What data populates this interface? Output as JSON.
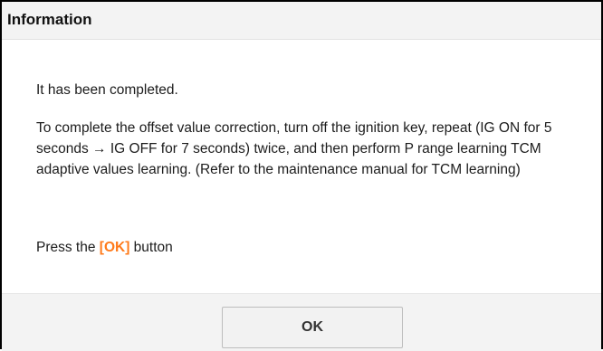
{
  "dialog": {
    "title": "Information",
    "message_line1": "It has been completed.",
    "message_body": "To complete the offset value correction, turn off the ignition key, repeat (IG ON for 5 seconds → IG OFF for 7 seconds) twice, and then perform P range learning TCM adaptive values learning. (Refer to the maintenance manual for TCM learning)",
    "press_prefix": "Press the ",
    "press_highlight": "[OK]",
    "press_suffix": " button",
    "ok_button_label": "OK"
  },
  "colors": {
    "highlight": "#ff7a1a",
    "header_bg": "#f3f3f3",
    "border": "#000000"
  }
}
